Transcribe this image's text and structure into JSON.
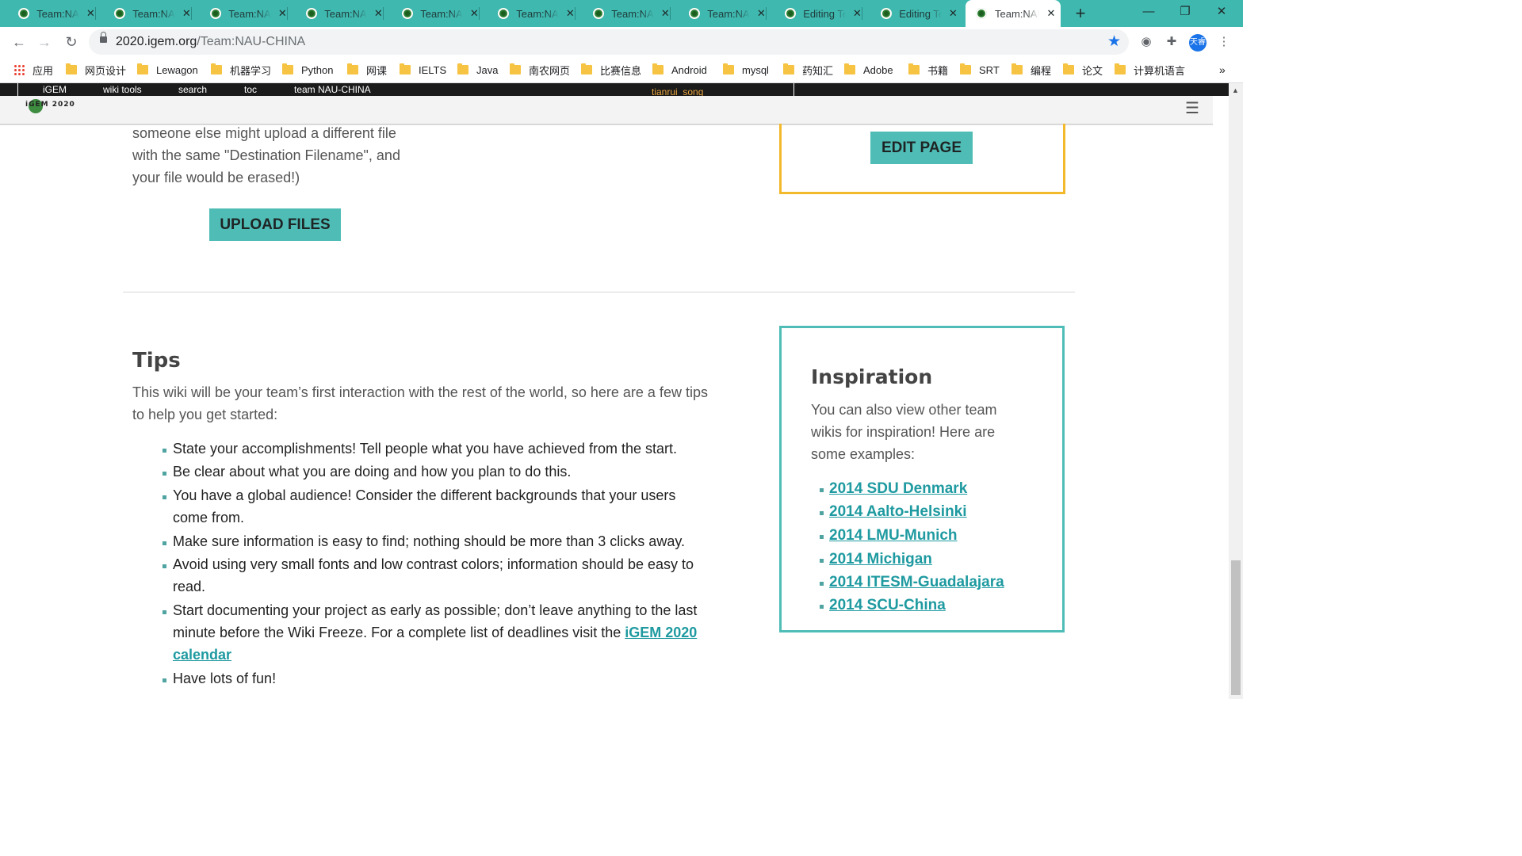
{
  "browser": {
    "tabs": [
      {
        "title": "Team:NAU-CHINA",
        "active": false
      },
      {
        "title": "Team:NAU-CHINA",
        "active": false
      },
      {
        "title": "Team:NAU-CHINA",
        "active": false
      },
      {
        "title": "Team:NAU-CHINA",
        "active": false
      },
      {
        "title": "Team:NAU-CHINA",
        "active": false
      },
      {
        "title": "Team:NAU-CHINA",
        "active": false
      },
      {
        "title": "Team:NAU-CHINA",
        "active": false
      },
      {
        "title": "Team:NAU-CHINA",
        "active": false
      },
      {
        "title": "Editing Team:NAU-CHINA",
        "active": false
      },
      {
        "title": "Editing Team:NAU-CHINA",
        "active": false
      },
      {
        "title": "Team:NAU-CHINA",
        "active": true
      }
    ],
    "close_glyph": "✕",
    "url_host": "2020.igem.org",
    "url_path": "/Team:NAU-CHINA",
    "profile_label": "天睿",
    "bookmarks": [
      {
        "label": "应用",
        "icon": "apps-icon"
      },
      {
        "label": "网页设计",
        "icon": "folder-icon"
      },
      {
        "label": "Lewagon",
        "icon": "folder-icon"
      },
      {
        "label": "机器学习",
        "icon": "folder-icon"
      },
      {
        "label": "Python",
        "icon": "folder-icon"
      },
      {
        "label": "网课",
        "icon": "folder-icon"
      },
      {
        "label": "IELTS",
        "icon": "folder-icon"
      },
      {
        "label": "Java",
        "icon": "folder-icon"
      },
      {
        "label": "南农网页",
        "icon": "folder-icon"
      },
      {
        "label": "比赛信息",
        "icon": "folder-icon"
      },
      {
        "label": "Android",
        "icon": "folder-icon"
      },
      {
        "label": "mysql",
        "icon": "folder-icon"
      },
      {
        "label": "药知汇",
        "icon": "folder-icon"
      },
      {
        "label": "Adobe",
        "icon": "folder-icon"
      },
      {
        "label": "书籍",
        "icon": "folder-icon"
      },
      {
        "label": "SRT",
        "icon": "folder-icon"
      },
      {
        "label": "编程",
        "icon": "folder-icon"
      },
      {
        "label": "论文",
        "icon": "folder-icon"
      },
      {
        "label": "计算机语言",
        "icon": "folder-icon"
      }
    ],
    "bookmarks_overflow": "»"
  },
  "igem_bar": {
    "items": [
      "iGEM",
      "wiki tools",
      "search",
      "toc",
      "team NAU-CHINA"
    ],
    "user": "tianrui_song"
  },
  "site_header": {
    "logo_text": "iGEM 2020"
  },
  "upload_section": {
    "text_lines": [
      "someone else might upload a different file",
      "with the same \"Destination Filename\", and",
      "your file would be erased!)"
    ],
    "upload_button": "UPLOAD FILES",
    "edit_button": "EDIT PAGE"
  },
  "tips": {
    "heading": "Tips",
    "intro_lines": [
      "This wiki will be your team’s first interaction with the rest of the world, so here are a few tips",
      "to help you get started:"
    ],
    "items": [
      "State your accomplishments! Tell people what you have achieved from the start.",
      "Be clear about what you are doing and how you plan to do this.",
      "You have a global audience! Consider the different backgrounds that your users come from.",
      "Make sure information is easy to find; nothing should be more than 3 clicks away.",
      "Avoid using very small fonts and low contrast colors; information should be easy to read.",
      "Start documenting your project as early as possible; don’t leave anything to the last minute before the Wiki Freeze. For a complete list of deadlines visit the ",
      "Have lots of fun!"
    ],
    "calendar_link": "iGEM 2020 calendar"
  },
  "inspiration": {
    "heading": "Inspiration",
    "text": "You can also view other team wikis for inspiration! Here are some examples:",
    "links": [
      "2014 SDU Denmark",
      "2014 Aalto-Helsinki",
      "2014 LMU-Munich",
      "2014 Michigan",
      "2014 ITESM-Guadalajara",
      "2014 SCU-China"
    ]
  },
  "colors": {
    "tab_strip": "#3fb8af",
    "accent_teal": "#4fbdb6",
    "edit_box_border": "#f2b92c",
    "link": "#1e9aa0"
  }
}
